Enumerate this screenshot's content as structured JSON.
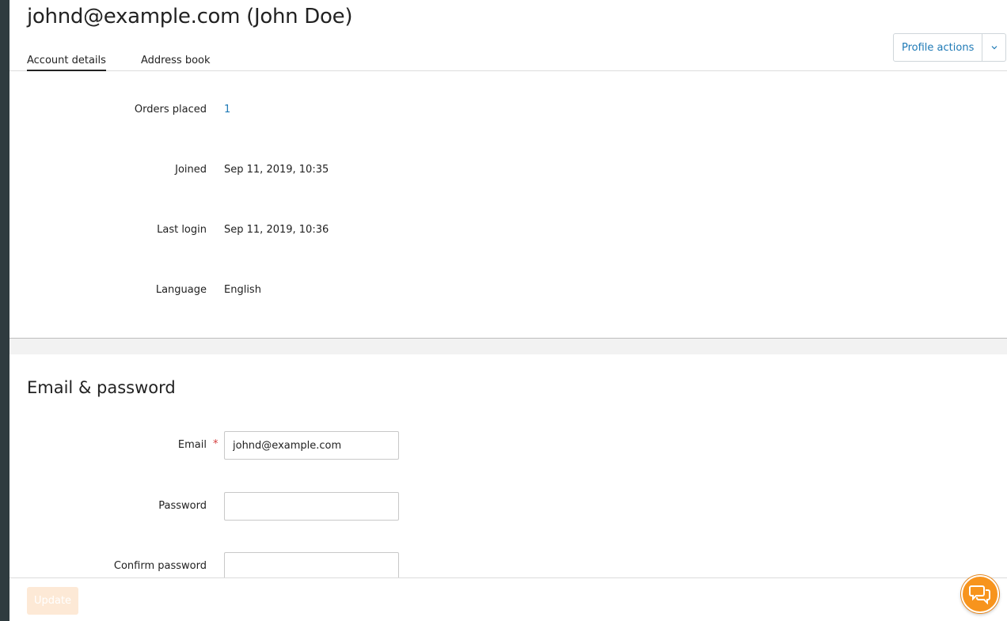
{
  "page": {
    "title": "johnd@example.com (John Doe)"
  },
  "tabs": [
    {
      "label": "Account details",
      "active": true
    },
    {
      "label": "Address book",
      "active": false
    }
  ],
  "profile_actions": {
    "label": "Profile actions",
    "caret_icon": "chevron-down-icon"
  },
  "details": {
    "orders_placed": {
      "label": "Orders placed",
      "value": "1"
    },
    "joined": {
      "label": "Joined",
      "value": "Sep 11, 2019, 10:35"
    },
    "last_login": {
      "label": "Last login",
      "value": "Sep 11, 2019, 10:36"
    },
    "language": {
      "label": "Language",
      "value": "English"
    }
  },
  "email_password": {
    "section_title": "Email & password",
    "email": {
      "label": "Email",
      "required_marker": "*",
      "value": "johnd@example.com"
    },
    "password": {
      "label": "Password",
      "value": ""
    },
    "confirm_password": {
      "label": "Confirm password",
      "value": ""
    }
  },
  "footer": {
    "update_label": "Update"
  },
  "chat": {
    "icon": "chat-bubbles-icon"
  },
  "colors": {
    "accent": "#1f7ab6",
    "sidebar": "#2f3b3f",
    "required": "#d43c3c",
    "chat": "#f7941d",
    "update_disabled": "#fde9d6"
  }
}
